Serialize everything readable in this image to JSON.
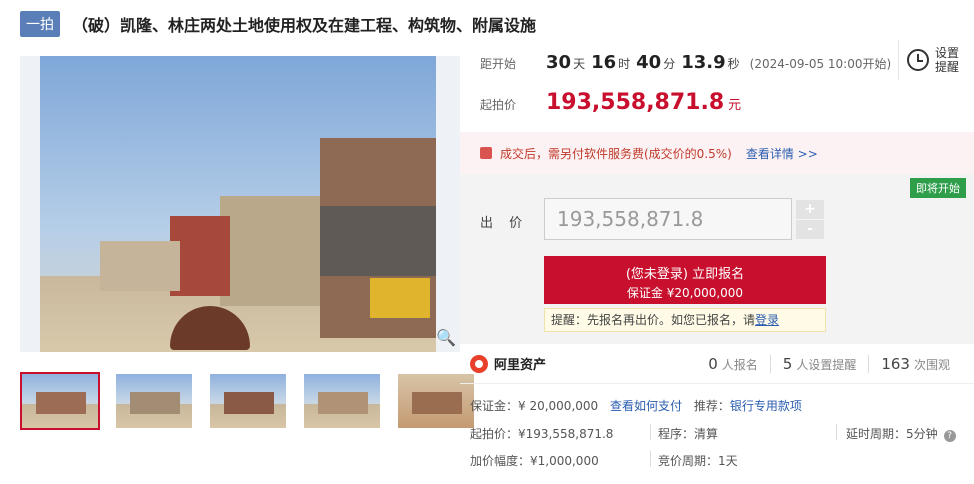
{
  "header": {
    "round_badge": "一拍",
    "title": "（破）凯隆、林庄两处土地使用权及在建工程、构筑物、附属设施"
  },
  "countdown": {
    "label": "距开始",
    "days": "30",
    "days_unit": "天",
    "hours": "16",
    "hours_unit": "时",
    "minutes": "40",
    "minutes_unit": "分",
    "seconds": "13.9",
    "seconds_unit": "秒",
    "start_text": "(2024-09-05 10:00开始)"
  },
  "start_price": {
    "label": "起拍价",
    "value": "193,558,871.8",
    "unit": "元"
  },
  "reminder": {
    "line1": "设置",
    "line2": "提醒"
  },
  "fee": {
    "text": "成交后，需另付软件服务费(成交价的0.5%)",
    "link": "查看详情 >>"
  },
  "bid": {
    "badge": "即将开始",
    "label": "出 价",
    "value": "193,558,871.8",
    "plus": "+",
    "minus": "-",
    "signup_main": "(您未登录) 立即报名",
    "signup_sub": "保证金 ¥20,000,000",
    "tip_prefix": "提醒：先报名再出价。如您已报名，请",
    "tip_link": "登录"
  },
  "brand": {
    "name": "阿里资产"
  },
  "stats": [
    {
      "num": "0",
      "label": "人报名"
    },
    {
      "num": "5",
      "label": "人设置提醒"
    },
    {
      "num": "163",
      "label": "次围观"
    }
  ],
  "info": {
    "deposit": "保证金：¥ 20,000,000",
    "deposit_link": "查看如何支付",
    "recommend_label": "推荐：",
    "recommend_link": "银行专用款项",
    "start_price": "起拍价：¥193,558,871.8",
    "procedure": "程序：清算",
    "delay": "延时周期：5分钟",
    "increment": "加价幅度：¥1,000,000",
    "cycle": "竞价周期：1天"
  },
  "colors": {
    "accent_red": "#c8102e",
    "link_blue": "#2a5db0",
    "badge_green": "#2e9e4b"
  }
}
